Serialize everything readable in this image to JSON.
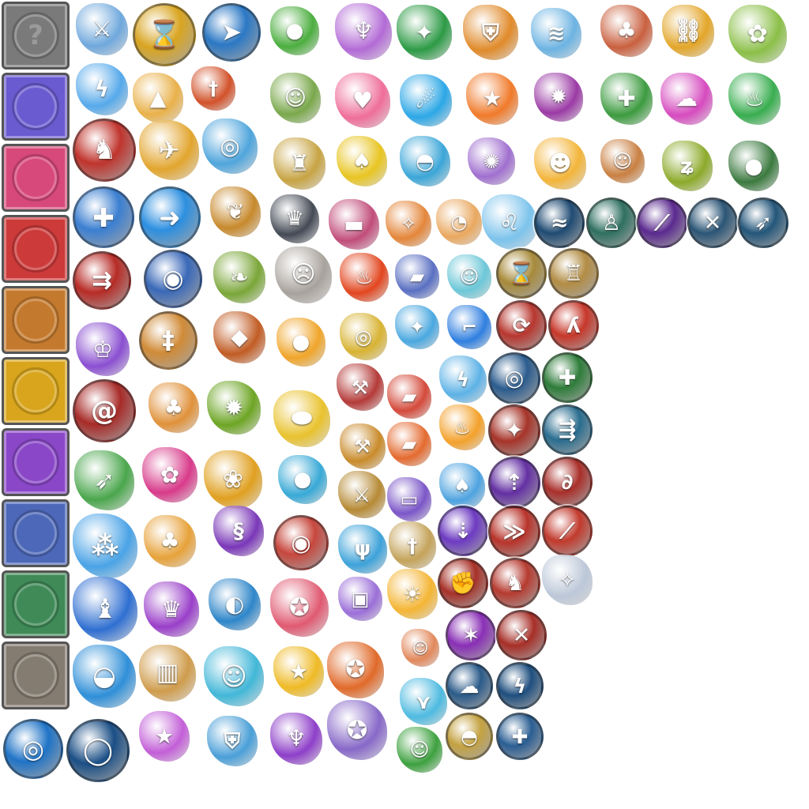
{
  "sheet": {
    "frames": [
      {
        "name": "frame-unknown",
        "color": "#7a7a7a",
        "label": "?"
      },
      {
        "name": "frame-rainbow",
        "color": "#6b5bd0"
      },
      {
        "name": "frame-pink",
        "color": "#d7497a"
      },
      {
        "name": "frame-red",
        "color": "#cc3a3a"
      },
      {
        "name": "frame-orange",
        "color": "#c47a2e"
      },
      {
        "name": "frame-yellow",
        "color": "#d8a51c"
      },
      {
        "name": "frame-purple",
        "color": "#8a48c8"
      },
      {
        "name": "frame-blue",
        "color": "#4d68b8"
      },
      {
        "name": "frame-green",
        "color": "#3f8a57"
      },
      {
        "name": "frame-gray",
        "color": "#857c71"
      }
    ],
    "icons": [
      {
        "name": "sword-icon",
        "color": "#6fa8dc",
        "glyph": "⚔"
      },
      {
        "name": "hourglass-icon",
        "color": "#d9a521",
        "glyph": "⌛",
        "badge": true
      },
      {
        "name": "arrow-burst-icon",
        "color": "#2b78c4",
        "glyph": "➤",
        "badge": true
      },
      {
        "name": "green-slime-icon",
        "color": "#4cae3f",
        "glyph": "●"
      },
      {
        "name": "jellyfish-icon",
        "color": "#b36bd6",
        "glyph": "♆"
      },
      {
        "name": "leaf-burst-icon",
        "color": "#2c9a45",
        "glyph": "✦"
      },
      {
        "name": "shield-icon",
        "color": "#e08a2a",
        "glyph": "⛨"
      },
      {
        "name": "scroll-icon",
        "color": "#6cb3e2",
        "glyph": "≋"
      },
      {
        "name": "mushroom-feather-icon",
        "color": "#c9603f",
        "glyph": "♣"
      },
      {
        "name": "broken-chain-icon",
        "color": "#e3a62a",
        "glyph": "⛓"
      },
      {
        "name": "cabbage-icon",
        "color": "#8bbf48",
        "glyph": "✿"
      },
      {
        "name": "lightning-icon",
        "color": "#56a9ea",
        "glyph": "ϟ"
      },
      {
        "name": "party-cake-icon",
        "color": "#e9b14a",
        "glyph": "▲"
      },
      {
        "name": "fire-sword-icon",
        "color": "#d2522a",
        "glyph": "†"
      },
      {
        "name": "bearded-mushroom-icon",
        "color": "#7aa84b",
        "glyph": "☺"
      },
      {
        "name": "heart-icon",
        "color": "#ef6e9a",
        "glyph": "♥"
      },
      {
        "name": "blue-comet-icon",
        "color": "#2ca7e6",
        "glyph": "☄"
      },
      {
        "name": "star-wand-icon",
        "color": "#f07a2a",
        "glyph": "★"
      },
      {
        "name": "thorn-fruit-icon",
        "color": "#9b3aa5",
        "glyph": "✹"
      },
      {
        "name": "cactus-icon",
        "color": "#3c9b3f",
        "glyph": "✚"
      },
      {
        "name": "pink-smoke-icon",
        "color": "#d64bbf",
        "glyph": "☁"
      },
      {
        "name": "green-sprout-pot-icon",
        "color": "#38ad4f",
        "glyph": "♨"
      },
      {
        "name": "running-man-icon",
        "color": "#c0342d",
        "glyph": "♞",
        "badge": true
      },
      {
        "name": "eagle-icon",
        "color": "#e2a52e",
        "glyph": "✈"
      },
      {
        "name": "tornado-icon",
        "color": "#4fa5dc",
        "glyph": "◎"
      },
      {
        "name": "knight-mushroom-icon",
        "color": "#c7a444",
        "glyph": "♜"
      },
      {
        "name": "pineapple-icon",
        "color": "#e8c522",
        "glyph": "♠"
      },
      {
        "name": "blue-mushroom-icon",
        "color": "#3ba6d8",
        "glyph": "◓"
      },
      {
        "name": "purple-crab-icon",
        "color": "#a06fcf",
        "glyph": "✺"
      },
      {
        "name": "yellow-hair-hero-icon",
        "color": "#f3b53a",
        "glyph": "☻"
      },
      {
        "name": "brown-mushroom-icon",
        "color": "#c98042",
        "glyph": "☺"
      },
      {
        "name": "golden-vine-icon",
        "color": "#8caa2a",
        "glyph": "ʑ"
      },
      {
        "name": "shadow-blob-icon",
        "color": "#3b7a3f",
        "glyph": "●"
      },
      {
        "name": "holy-shield-icon",
        "color": "#3b7fd1",
        "glyph": "✚",
        "badge": true
      },
      {
        "name": "blue-arrow-icon",
        "color": "#2d8fe0",
        "glyph": "➜",
        "badge": true
      },
      {
        "name": "maple-leaf-icon",
        "color": "#c7892c",
        "glyph": "❦"
      },
      {
        "name": "dark-rider-icon",
        "color": "#444a55",
        "glyph": "♛"
      },
      {
        "name": "rocket-launcher-icon",
        "color": "#c14d7a",
        "glyph": "▬"
      },
      {
        "name": "fire-branch-icon",
        "color": "#e4863a",
        "glyph": "✧"
      },
      {
        "name": "cannon-bird-icon",
        "color": "#e9a85f",
        "glyph": "◔"
      },
      {
        "name": "ice-lion-icon",
        "color": "#7cc3ec",
        "glyph": "♌"
      },
      {
        "name": "wind-slash-icon",
        "color": "#1f4b73",
        "glyph": "≈",
        "badge": true
      },
      {
        "name": "warrior-stance-icon",
        "color": "#2f7061",
        "glyph": "♙",
        "badge": true
      },
      {
        "name": "purple-slash-icon",
        "color": "#5b2a8f",
        "glyph": "⟋",
        "badge": true
      },
      {
        "name": "shatter-icon",
        "color": "#2b5576",
        "glyph": "✕",
        "badge": true
      },
      {
        "name": "bow-shot-icon",
        "color": "#23567a",
        "glyph": "➶",
        "badge": true
      },
      {
        "name": "multi-arrow-icon",
        "color": "#b72b26",
        "glyph": "⇉",
        "badge": true
      },
      {
        "name": "blue-cannon-icon",
        "color": "#3a69b8",
        "glyph": "◉",
        "badge": true
      },
      {
        "name": "sprout-icon",
        "color": "#7aa638",
        "glyph": "❧"
      },
      {
        "name": "rock-monster-icon",
        "color": "#a8a29c",
        "glyph": "☹"
      },
      {
        "name": "fire-slime-icon",
        "color": "#e2461f",
        "glyph": "♨"
      },
      {
        "name": "race-car-icon",
        "color": "#5a6fc2",
        "glyph": "▰"
      },
      {
        "name": "frost-face-icon",
        "color": "#6cc7d8",
        "glyph": "☺"
      },
      {
        "name": "gold-hourglass-icon",
        "color": "#a78a3a",
        "glyph": "⌛",
        "badge": true
      },
      {
        "name": "gold-armor-icon",
        "color": "#b38d45",
        "glyph": "♖",
        "badge": true
      },
      {
        "name": "crown-cards-icon",
        "color": "#8a4fd1",
        "glyph": "♔"
      },
      {
        "name": "sword-rain-icon",
        "color": "#d08b38",
        "glyph": "‡",
        "badge": true
      },
      {
        "name": "rock-fall-icon",
        "color": "#c15c24",
        "glyph": "◆"
      },
      {
        "name": "fireball-icon",
        "color": "#f0a52a",
        "glyph": "●"
      },
      {
        "name": "gold-bomb-icon",
        "color": "#d8b333",
        "glyph": "◎"
      },
      {
        "name": "blue-dragonfly-icon",
        "color": "#4aa8e0",
        "glyph": "✦"
      },
      {
        "name": "blue-boot-icon",
        "color": "#2f7fe0",
        "glyph": "⌐"
      },
      {
        "name": "red-sweep-icon",
        "color": "#b8372f",
        "glyph": "⟳",
        "badge": true
      },
      {
        "name": "red-claw-icon",
        "color": "#c7372a",
        "glyph": "ʎ",
        "badge": true
      },
      {
        "name": "vortex-icon",
        "color": "#a72b28",
        "glyph": "@",
        "badge": true
      },
      {
        "name": "mushroom-bounce-icon",
        "color": "#e0913a",
        "glyph": "♣"
      },
      {
        "name": "green-burst-icon",
        "color": "#6da524",
        "glyph": "✹"
      },
      {
        "name": "gold-pile-icon",
        "color": "#e9c22e",
        "glyph": "⬬"
      },
      {
        "name": "red-axe-icon",
        "color": "#b43b39",
        "glyph": "⚒"
      },
      {
        "name": "red-kart-icon",
        "color": "#d44a3b",
        "glyph": "▰"
      },
      {
        "name": "blue-lightning-icon",
        "color": "#5db2e6",
        "glyph": "ϟ"
      },
      {
        "name": "blue-tornado-icon",
        "color": "#2b5c8e",
        "glyph": "◎",
        "badge": true
      },
      {
        "name": "green-heal-icon",
        "color": "#2e7d3a",
        "glyph": "✚",
        "badge": true
      },
      {
        "name": "green-arrow-icon",
        "color": "#4aa64c",
        "glyph": "➶"
      },
      {
        "name": "pink-flower-icon",
        "color": "#d83a8a",
        "glyph": "✿"
      },
      {
        "name": "sunflower-icon",
        "color": "#e0a020",
        "glyph": "❀"
      },
      {
        "name": "blue-dash-icon",
        "color": "#38a9d6",
        "glyph": "●"
      },
      {
        "name": "gold-hammer-icon",
        "color": "#c98b2b",
        "glyph": "⚒"
      },
      {
        "name": "fire-kart-icon",
        "color": "#e46a2f",
        "glyph": "▰"
      },
      {
        "name": "flame-feather-icon",
        "color": "#f3a12b",
        "glyph": "♨"
      },
      {
        "name": "red-debris-icon",
        "color": "#a63429",
        "glyph": "✦",
        "badge": true
      },
      {
        "name": "triple-arrow-icon",
        "color": "#2a6d8f",
        "glyph": "⇶",
        "badge": true
      },
      {
        "name": "ornate-axe-icon",
        "color": "#b68a35",
        "glyph": "⚔"
      },
      {
        "name": "magic-carpet-icon",
        "color": "#7b56c8",
        "glyph": "▭"
      },
      {
        "name": "small-mushroom-icon",
        "color": "#4ea3e0",
        "glyph": "♠"
      },
      {
        "name": "purple-up-arrow-icon",
        "color": "#6430a3",
        "glyph": "⇡",
        "badge": true
      },
      {
        "name": "red-hook-icon",
        "color": "#a92f2a",
        "glyph": "∂",
        "badge": true
      },
      {
        "name": "triple-orb-icon",
        "color": "#4aa3e6",
        "glyph": "⁂"
      },
      {
        "name": "yellow-mushroom-icon",
        "color": "#e7a23a",
        "glyph": "♣"
      },
      {
        "name": "purple-tentacle-icon",
        "color": "#7a37b8",
        "glyph": "§"
      },
      {
        "name": "red-gear-token-icon",
        "color": "#c7473d",
        "glyph": "◉",
        "badge": true
      },
      {
        "name": "ice-trident-icon",
        "color": "#3da2d9",
        "glyph": "ψ"
      },
      {
        "name": "gold-sword-icon",
        "color": "#c4a35a",
        "glyph": "†"
      },
      {
        "name": "purple-arrow-down-icon",
        "color": "#6d3bc2",
        "glyph": "⇣",
        "badge": true
      },
      {
        "name": "red-dash-icon",
        "color": "#b8342b",
        "glyph": "≫",
        "badge": true
      },
      {
        "name": "red-blade-icon",
        "color": "#c23a2d",
        "glyph": "⟋",
        "badge": true
      },
      {
        "name": "blue-dragon-icon",
        "color": "#2f6fd1",
        "glyph": "♝"
      },
      {
        "name": "purple-witch-icon",
        "color": "#9a3fc9",
        "glyph": "♛"
      },
      {
        "name": "pearl-clam-icon",
        "color": "#2e86c9",
        "glyph": "◐"
      },
      {
        "name": "pink-gear-icon",
        "color": "#e05a72",
        "glyph": "✪"
      },
      {
        "name": "gift-box-icon",
        "color": "#9b6fd8",
        "glyph": "▣"
      },
      {
        "name": "sun-swirl-icon",
        "color": "#f4b534",
        "glyph": "☀"
      },
      {
        "name": "red-fist-icon",
        "color": "#a73128",
        "glyph": "✊",
        "badge": true
      },
      {
        "name": "red-runner-icon",
        "color": "#b63b30",
        "glyph": "♞",
        "badge": true
      },
      {
        "name": "winged-crest-icon",
        "color": "#bcc7d8",
        "glyph": "✧"
      },
      {
        "name": "blue-splash-icon",
        "color": "#2f8fd8",
        "glyph": "◒"
      },
      {
        "name": "wooden-fence-icon",
        "color": "#cf9c4c",
        "glyph": "▥"
      },
      {
        "name": "cyan-ghost-icon",
        "color": "#42b7d8",
        "glyph": "☺"
      },
      {
        "name": "gold-star-icon",
        "color": "#efba25",
        "glyph": "★"
      },
      {
        "name": "orange-gear-icon",
        "color": "#e06a2a",
        "glyph": "✪"
      },
      {
        "name": "mushroom-man-icon",
        "color": "#e2885b",
        "glyph": "☺"
      },
      {
        "name": "purple-beam-icon",
        "color": "#8a2fb6",
        "glyph": "✶",
        "badge": true
      },
      {
        "name": "red-spark-icon",
        "color": "#a72f28",
        "glyph": "✕",
        "badge": true
      },
      {
        "name": "blue-cyclone-icon",
        "color": "#1f73c6",
        "glyph": "◎",
        "badge": true
      },
      {
        "name": "blue-ring-icon",
        "color": "#1b4f86",
        "glyph": "◯",
        "badge": true
      },
      {
        "name": "star-shards-icon",
        "color": "#c35fd8",
        "glyph": "★"
      },
      {
        "name": "crystal-shield-icon",
        "color": "#4a9fd8",
        "glyph": "⛨"
      },
      {
        "name": "purple-bat-icon",
        "color": "#8e3fc9",
        "glyph": "♆"
      },
      {
        "name": "purple-gear-icon",
        "color": "#8768c8",
        "glyph": "✪"
      },
      {
        "name": "fish-tail-icon",
        "color": "#4ebae0",
        "glyph": "⋎"
      },
      {
        "name": "blue-cloud-icon",
        "color": "#2b5b8a",
        "glyph": "☁",
        "badge": true
      },
      {
        "name": "blue-bolt-icon",
        "color": "#1f4f7f",
        "glyph": "ϟ",
        "badge": true
      },
      {
        "name": "green-frog-icon",
        "color": "#3da13f",
        "glyph": "☺"
      },
      {
        "name": "gold-disc-icon",
        "color": "#c4a241",
        "glyph": "◓",
        "badge": true
      },
      {
        "name": "blue-cross-shield-icon",
        "color": "#2a5e93",
        "glyph": "✚",
        "badge": true
      }
    ]
  }
}
